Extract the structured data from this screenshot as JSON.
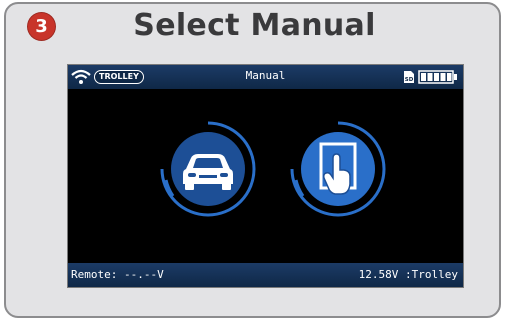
{
  "step": {
    "number": "3",
    "color": "#c8342a"
  },
  "title": "Select Manual",
  "device": {
    "status_bar": {
      "wifi_icon": "wifi-icon",
      "badge": "TROLLEY",
      "title": "Manual",
      "sd_label": "SD",
      "battery_icon": "battery-full-icon"
    },
    "modes": [
      {
        "name": "auto",
        "icon": "car-icon"
      },
      {
        "name": "manual",
        "icon": "hand-pointer-icon",
        "selected": true
      }
    ],
    "bottom_bar": {
      "remote": "Remote: --.--V",
      "voltage": "12.58V :Trolley"
    },
    "colors": {
      "bar": "#0f2847",
      "accent": "#2a6fc9",
      "screen": "#000000"
    }
  }
}
